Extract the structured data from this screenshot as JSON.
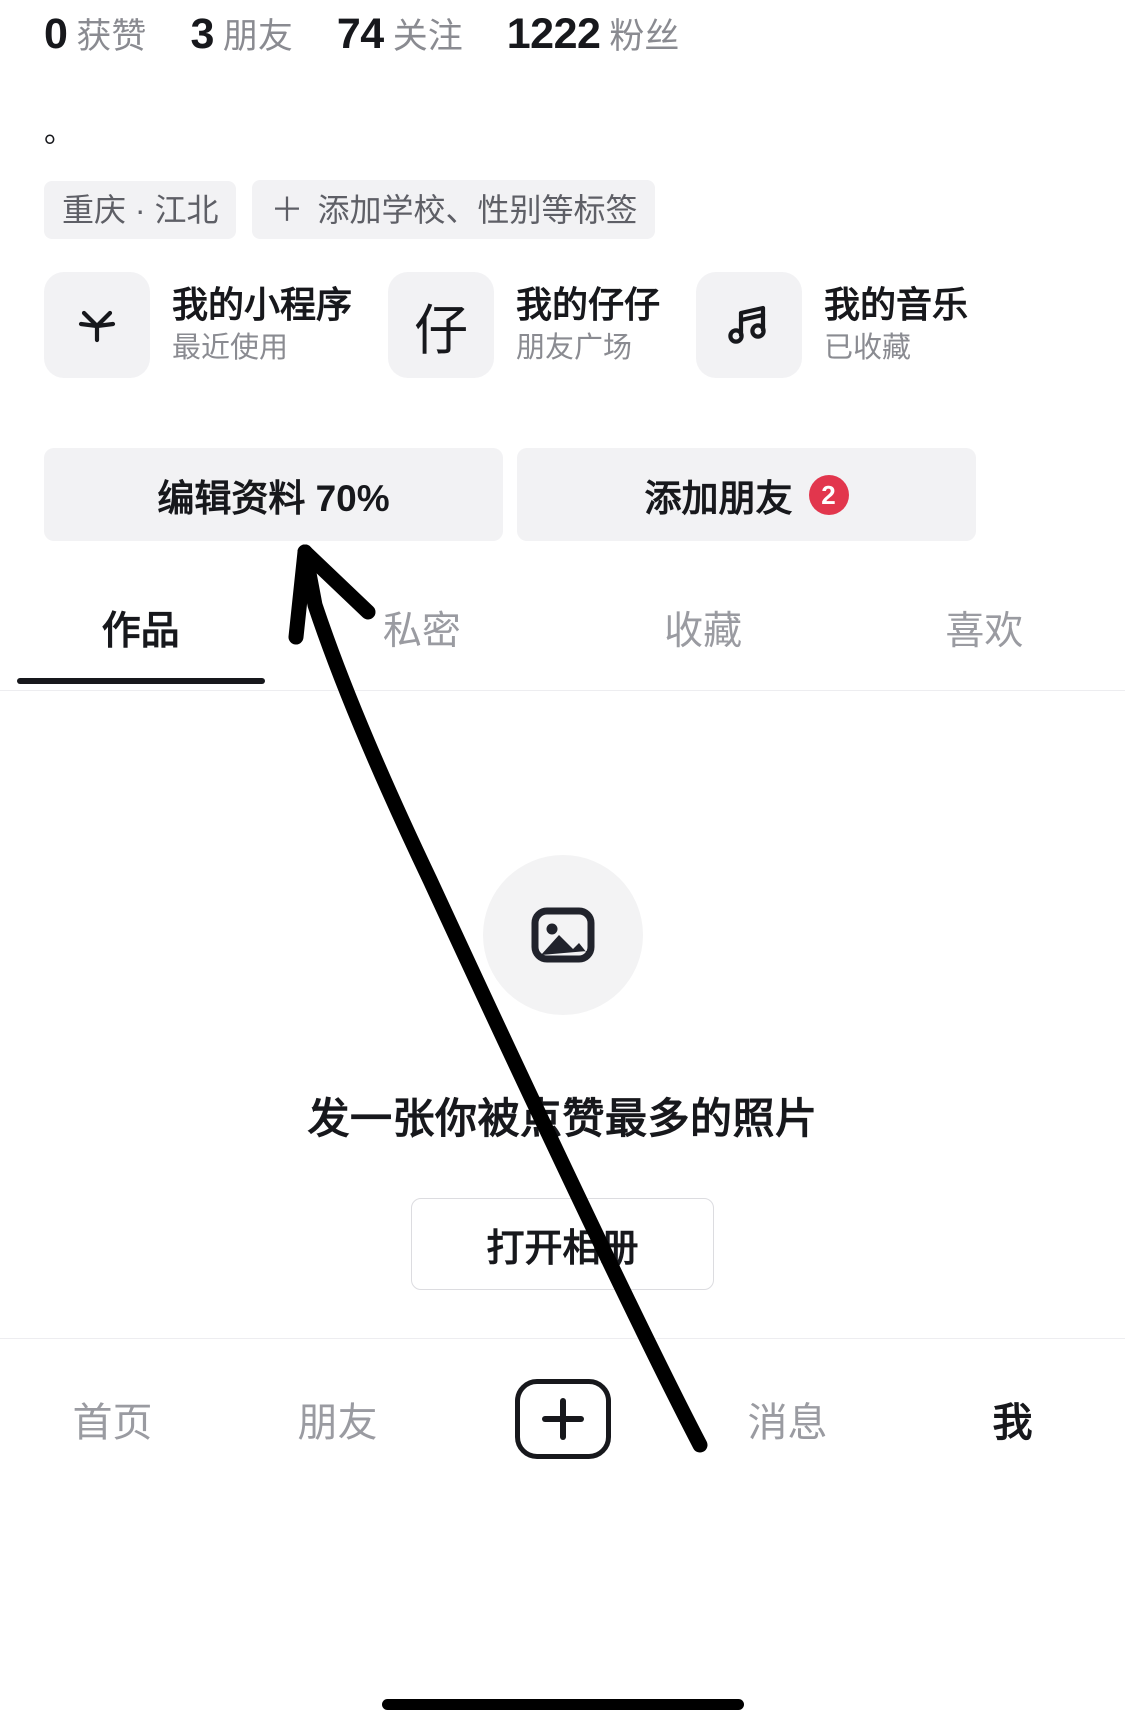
{
  "stats": [
    {
      "value": "0",
      "label": "获赞"
    },
    {
      "value": "3",
      "label": "朋友"
    },
    {
      "value": "74",
      "label": "关注"
    },
    {
      "value": "1222",
      "label": "粉丝"
    }
  ],
  "signature": "。",
  "tags": {
    "location": "重庆 · 江北",
    "add_plus": "＋",
    "add_label": "添加学校、性别等标签"
  },
  "shortcuts": [
    {
      "icon": "mini-program-star-icon",
      "title": "我的小程序",
      "subtitle": "最近使用"
    },
    {
      "icon": "zaizai-glyph-icon",
      "title": "我的仔仔",
      "subtitle": "朋友广场",
      "glyph": "仔"
    },
    {
      "icon": "music-note-icon",
      "title": "我的音乐",
      "subtitle": "已收藏"
    }
  ],
  "actions": {
    "edit_profile": "编辑资料 70%",
    "add_friend": "添加朋友",
    "add_friend_badge": "2"
  },
  "tabs": [
    {
      "label": "作品",
      "active": true
    },
    {
      "label": "私密",
      "active": false
    },
    {
      "label": "收藏",
      "active": false
    },
    {
      "label": "喜欢",
      "active": false
    }
  ],
  "empty_state": {
    "icon": "photo-placeholder-icon",
    "title": "发一张你被点赞最多的照片",
    "button": "打开相册"
  },
  "bottom_nav": [
    {
      "label": "首页",
      "active": false
    },
    {
      "label": "朋友",
      "active": false
    },
    {
      "label": "＋",
      "active": false
    },
    {
      "label": "消息",
      "active": false
    },
    {
      "label": "我",
      "active": true
    }
  ],
  "annotation": {
    "type": "hand-drawn-arrow",
    "color": "#000000",
    "points_to": "编辑资料 70%"
  },
  "colors": {
    "text_primary": "#17181c",
    "text_secondary": "#8a8b91",
    "chip_bg": "#f2f2f4",
    "badge_red": "#e2364d",
    "page_bg": "#ffffff"
  }
}
